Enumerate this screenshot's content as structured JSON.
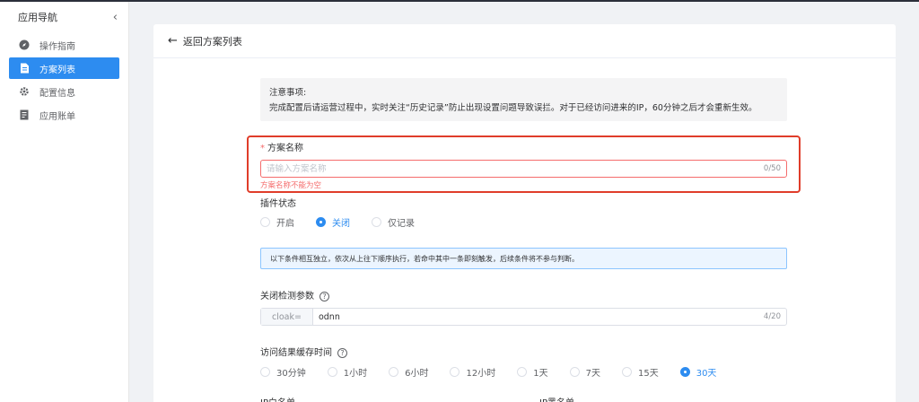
{
  "sidebar": {
    "title": "应用导航",
    "collapse_icon": "chevron-left-icon",
    "items": [
      {
        "label": "操作指南",
        "icon": "compass-icon",
        "active": false
      },
      {
        "label": "方案列表",
        "icon": "document-icon",
        "active": true
      },
      {
        "label": "配置信息",
        "icon": "gear-icon",
        "active": false
      },
      {
        "label": "应用账单",
        "icon": "bill-icon",
        "active": false
      }
    ]
  },
  "header": {
    "back_label": "返回方案列表"
  },
  "notice": {
    "title": "注意事项:",
    "body": "完成配置后请运营过程中，实时关注“历史记录”防止出现设置问题导致误拦。对于已经访问进来的IP，60分钟之后才会重新生效。"
  },
  "plan_name": {
    "required_mark": "*",
    "label": "方案名称",
    "placeholder": "请输入方案名称",
    "value": "",
    "counter": "0/50",
    "error": "方案名称不能为空"
  },
  "plugin_status": {
    "label": "插件状态",
    "options": [
      "开启",
      "关闭",
      "仅记录"
    ],
    "selected": "关闭"
  },
  "info": {
    "text": "以下条件相互独立，依次从上往下顺序执行，若命中其中一条即刻触发，后续条件将不参与判断。"
  },
  "close_param": {
    "label": "关闭检测参数",
    "prefix": "cloak=",
    "value": "odnn",
    "counter": "4/20"
  },
  "cache_time": {
    "label": "访问结果缓存时间",
    "options": [
      "30分钟",
      "1小时",
      "6小时",
      "12小时",
      "1天",
      "7天",
      "15天",
      "30天"
    ],
    "selected": "30天"
  },
  "lists": {
    "whitelist_label": "IP白名单",
    "blacklist_label": "IP黑名单"
  },
  "colors": {
    "accent": "#2d8cf0",
    "error": "#e03d2a",
    "sidebar_active": "#2d8cf0"
  }
}
